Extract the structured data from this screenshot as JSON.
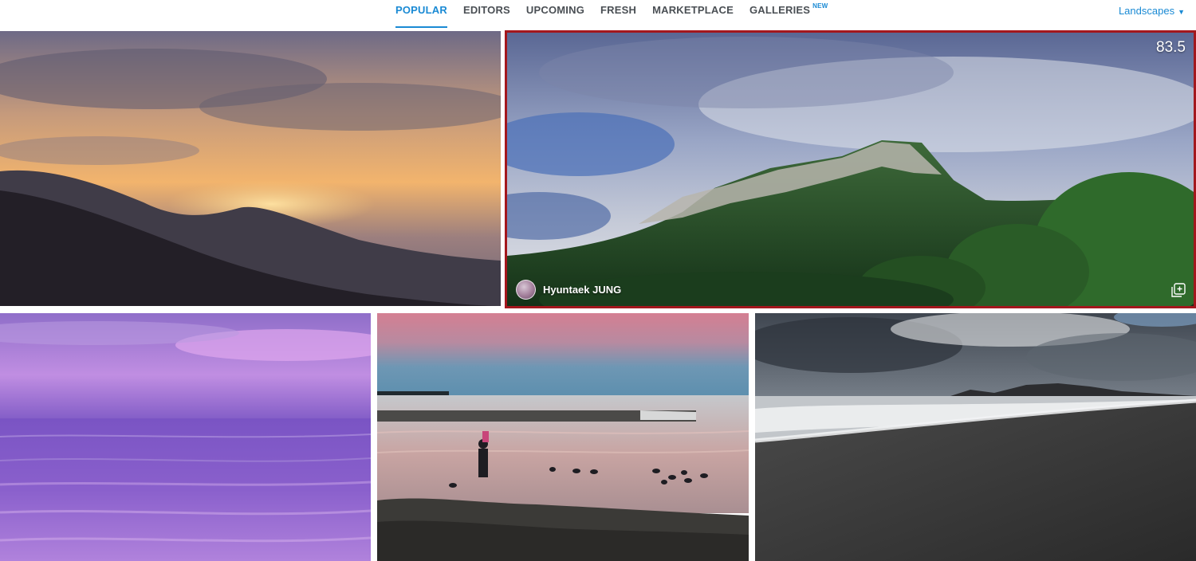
{
  "nav": {
    "tabs": [
      {
        "label": "POPULAR",
        "active": true
      },
      {
        "label": "EDITORS",
        "active": false
      },
      {
        "label": "UPCOMING",
        "active": false
      },
      {
        "label": "FRESH",
        "active": false
      },
      {
        "label": "MARKETPLACE",
        "active": false
      },
      {
        "label": "GALLERIES",
        "active": false,
        "badge": "NEW"
      }
    ],
    "category": {
      "label": "Landscapes",
      "icon": "chevron-down-icon"
    }
  },
  "colors": {
    "accent": "#1a8ad4",
    "highlight_border": "#a3171d",
    "nav_text": "#4a4f54"
  },
  "photos": [
    {
      "scene": "sunset-over-mountains"
    },
    {
      "scene": "cloudy-rocky-mountain-peak",
      "score": "83.5",
      "author": "Hyuntaek JUNG",
      "highlighted": true,
      "icons": [
        "avatar",
        "add-to-gallery-icon"
      ]
    },
    {
      "scene": "purple-sea-at-dusk"
    },
    {
      "scene": "person-and-geese-at-lakeshore"
    },
    {
      "scene": "black-sand-beach-with-waves"
    }
  ]
}
